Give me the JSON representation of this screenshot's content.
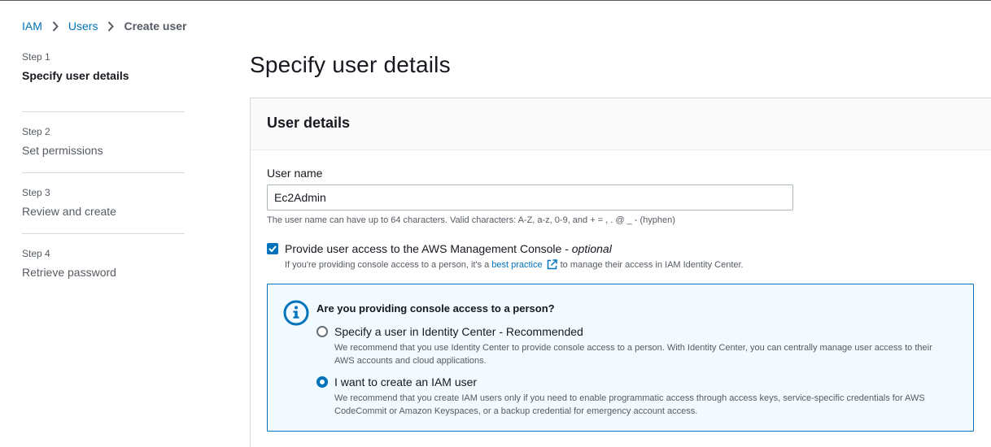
{
  "breadcrumb": {
    "items": [
      "IAM",
      "Users"
    ],
    "current": "Create user"
  },
  "steps": [
    {
      "num": "Step 1",
      "title": "Specify user details",
      "active": true
    },
    {
      "num": "Step 2",
      "title": "Set permissions",
      "active": false
    },
    {
      "num": "Step 3",
      "title": "Review and create",
      "active": false
    },
    {
      "num": "Step 4",
      "title": "Retrieve password",
      "active": false
    }
  ],
  "page_title": "Specify user details",
  "panel": {
    "title": "User details",
    "user_name_label": "User name",
    "user_name_value": "Ec2Admin",
    "user_name_hint": "The user name can have up to 64 characters. Valid characters: A-Z, a-z, 0-9, and + = , . @ _ - (hyphen)",
    "console_access": {
      "label": "Provide user access to the AWS Management Console - ",
      "label_optional": "optional",
      "checked": true,
      "desc_before": "If you're providing console access to a person, it's a",
      "desc_link": "best practice",
      "desc_after": "to manage their access in IAM Identity Center."
    },
    "info": {
      "heading": "Are you providing console access to a person?",
      "options": [
        {
          "label": "Specify a user in Identity Center - Recommended",
          "desc": "We recommend that you use Identity Center to provide console access to a person. With Identity Center, you can centrally manage user access to their AWS accounts and cloud applications.",
          "checked": false
        },
        {
          "label": "I want to create an IAM user",
          "desc": "We recommend that you create IAM users only if you need to enable programmatic access through access keys, service-specific credentials for AWS CodeCommit or Amazon Keyspaces, or a backup credential for emergency account access.",
          "checked": true
        }
      ]
    }
  },
  "colors": {
    "link": "#0073bb",
    "info_bg": "#f1faff",
    "text": "#16191f",
    "muted": "#545b64"
  }
}
